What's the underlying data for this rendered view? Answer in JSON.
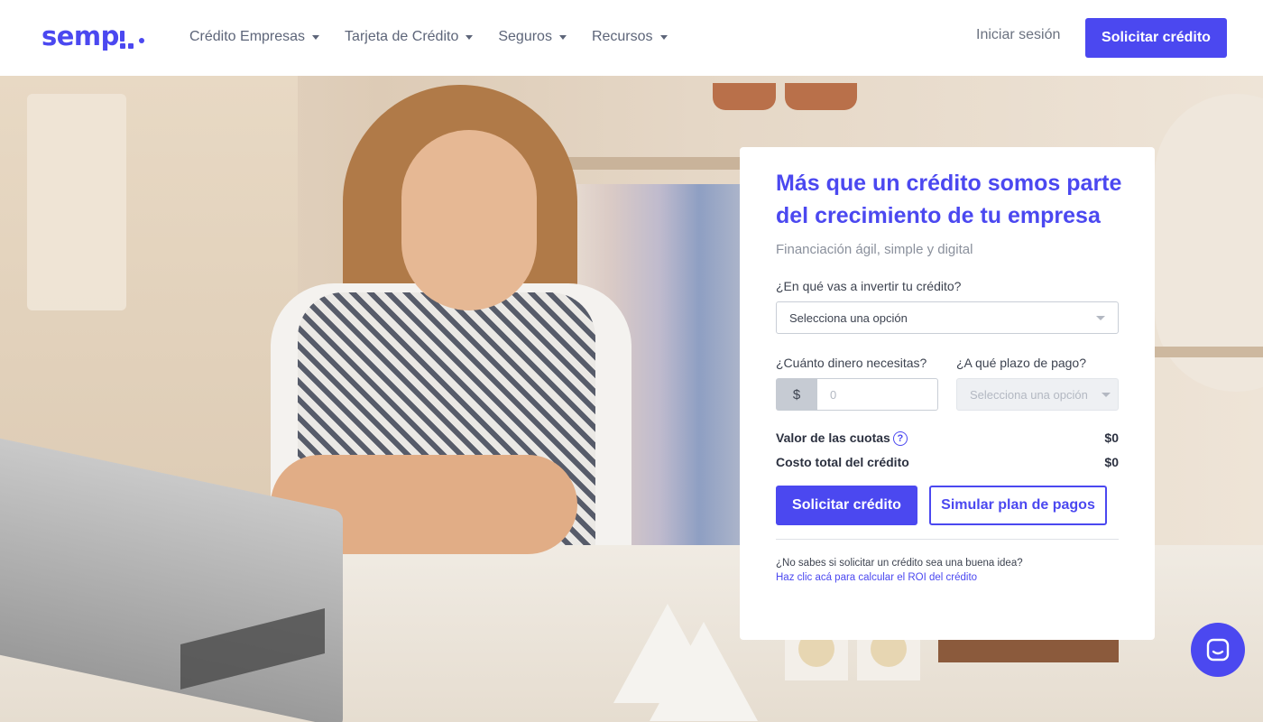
{
  "header": {
    "logo_text": "semp",
    "nav": [
      {
        "label": "Crédito Empresas"
      },
      {
        "label": "Tarjeta de Crédito"
      },
      {
        "label": "Seguros"
      },
      {
        "label": "Recursos"
      }
    ],
    "login_label": "Iniciar sesión",
    "cta_label": "Solicitar crédito"
  },
  "form": {
    "title": "Más que un crédito somos parte del crecimiento de tu empresa",
    "subtitle": "Financiación ágil, simple y digital",
    "invest_label": "¿En qué vas a invertir tu crédito?",
    "invest_select": "Selecciona una opción",
    "amount_label": "¿Cuánto dinero necesitas?",
    "currency_symbol": "$",
    "amount_placeholder": "0",
    "term_label": "¿A qué plazo de pago?",
    "term_select": "Selecciona una opción",
    "installments_label": "Valor de las cuotas",
    "installments_value": "$0",
    "total_label": "Costo total del crédito",
    "total_value": "$0",
    "submit_label": "Solicitar crédito",
    "simulate_label": "Simular plan de pagos",
    "roi_question": "¿No sabes si solicitar un crédito sea una buena idea?",
    "roi_link": "Haz clic acá para calcular el ROI del crédito"
  },
  "colors": {
    "accent": "#4b48f0",
    "text": "#3d4350",
    "muted": "#8a909c"
  },
  "icons": {
    "help": "question-circle-icon",
    "chat": "chat-bubble-icon",
    "caret": "caret-down-icon"
  }
}
